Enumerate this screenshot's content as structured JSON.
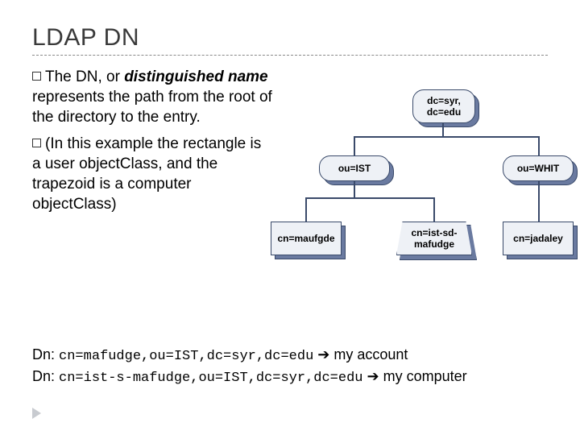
{
  "title": "LDAP DN",
  "bullets": {
    "b1_pre": "The DN, or ",
    "b1_em": "distinguished name",
    "b1_post": " represents the path from the root of the directory to the entry.",
    "b2": "(In this example the rectangle is a user objectClass, and the trapezoid is a computer objectClass)"
  },
  "tree": {
    "root": "dc=syr, dc=edu",
    "ou_left": "ou=IST",
    "ou_right": "ou=WHIT",
    "cn1": "cn=maufgde",
    "cn2": "cn=ist-sd-mafudge",
    "cn3": "cn=jadaley"
  },
  "footer": {
    "l1_pre": "Dn: ",
    "l1_dn": "cn=mafudge,ou=IST,dc=syr,dc=edu",
    "l1_arrow": " ➔ ",
    "l1_post": "my account",
    "l2_pre": "Dn: ",
    "l2_dn": "cn=ist-s-mafudge,ou=IST,dc=syr,dc=edu",
    "l2_arrow": " ➔ ",
    "l2_post": "my computer"
  }
}
